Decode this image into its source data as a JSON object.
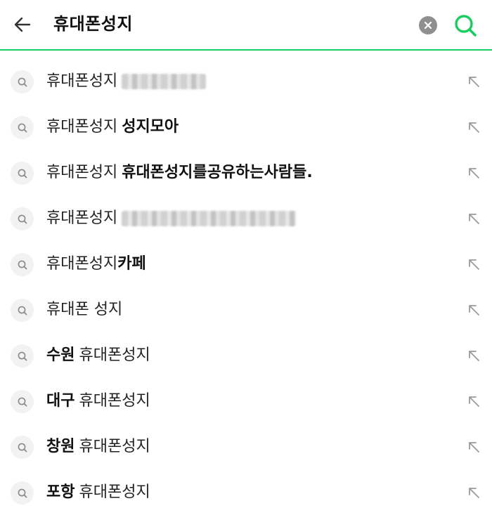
{
  "header": {
    "query": "휴대폰성지",
    "back_icon": "arrow-left-icon",
    "clear_icon": "clear-x-icon",
    "search_icon": "search-icon",
    "accent": "#19ce60"
  },
  "suggestions": [
    {
      "prefix": "휴대폰성지",
      "suffix": "",
      "suffix_bold": false,
      "redacted": true
    },
    {
      "prefix": "휴대폰성지",
      "suffix": "성지모아",
      "suffix_bold": true,
      "redacted": false
    },
    {
      "prefix": "휴대폰성지",
      "suffix": "휴대폰성지를공유하는사람들.",
      "suffix_bold": true,
      "redacted": false
    },
    {
      "prefix": "휴대폰성지",
      "suffix": "",
      "suffix_bold": false,
      "redacted": true
    },
    {
      "prefix": "휴대폰성지",
      "suffix": "카페",
      "suffix_bold": true,
      "redacted": false,
      "no_space": true
    },
    {
      "prefix": "휴대폰 성지",
      "suffix": "",
      "suffix_bold": false,
      "redacted": false
    },
    {
      "prefix": "수원",
      "prefix_bold": true,
      "suffix": "휴대폰성지",
      "suffix_bold": false,
      "redacted": false
    },
    {
      "prefix": "대구",
      "prefix_bold": true,
      "suffix": "휴대폰성지",
      "suffix_bold": false,
      "redacted": false
    },
    {
      "prefix": "창원",
      "prefix_bold": true,
      "suffix": "휴대폰성지",
      "suffix_bold": false,
      "redacted": false
    },
    {
      "prefix": "포항",
      "prefix_bold": true,
      "suffix": "휴대폰성지",
      "suffix_bold": false,
      "redacted": false
    }
  ],
  "row_icons": {
    "left": "search-icon",
    "right": "arrow-up-left-icon"
  }
}
